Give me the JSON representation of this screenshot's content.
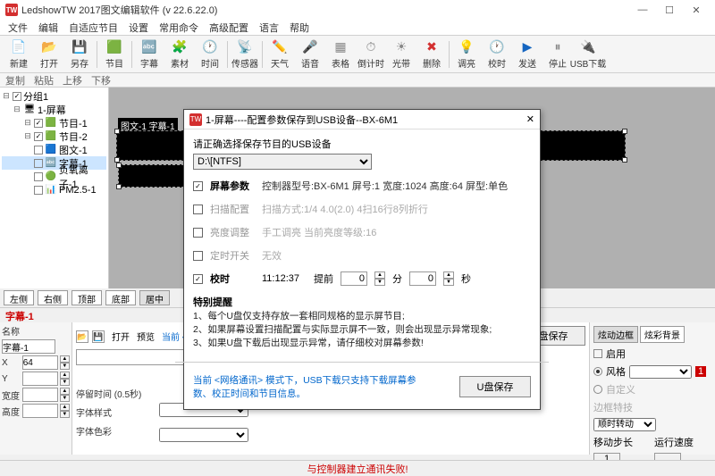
{
  "window": {
    "title": "LedshowTW 2017图文编辑软件 (v 22.6.22.0)",
    "min": "—",
    "max": "☐",
    "close": "✕"
  },
  "menu": [
    "文件",
    "编辑",
    "自适应节目",
    "设置",
    "常用命令",
    "高级配置",
    "语言",
    "帮助"
  ],
  "toolbar": [
    {
      "icon": "📄",
      "label": "新建",
      "color": "c-blue"
    },
    {
      "icon": "📂",
      "label": "打开",
      "color": "c-orange"
    },
    {
      "icon": "💾",
      "label": "另存",
      "color": "c-blue"
    },
    {
      "sep": true
    },
    {
      "icon": "🟩",
      "label": "节目",
      "color": "c-green"
    },
    {
      "sep": true
    },
    {
      "icon": "🔤",
      "label": "字幕",
      "color": "c-blue"
    },
    {
      "icon": "🧩",
      "label": "素材",
      "color": "c-green"
    },
    {
      "icon": "🕐",
      "label": "时间",
      "color": "c-green"
    },
    {
      "sep": true
    },
    {
      "icon": "📡",
      "label": "传感器",
      "color": "c-blue"
    },
    {
      "sep": true
    },
    {
      "icon": "✏️",
      "label": "天气",
      "color": "c-blue"
    },
    {
      "icon": "🎤",
      "label": "语音",
      "color": "c-gray"
    },
    {
      "icon": "▦",
      "label": "表格",
      "color": "c-gray"
    },
    {
      "icon": "⏱",
      "label": "倒计时",
      "color": "c-gray"
    },
    {
      "icon": "☀",
      "label": "光带",
      "color": "c-gray"
    },
    {
      "icon": "✖",
      "label": "删除",
      "color": "c-red"
    },
    {
      "sep": true
    },
    {
      "icon": "💡",
      "label": "调亮",
      "color": "c-orange"
    },
    {
      "icon": "🕐",
      "label": "校时",
      "color": "c-green"
    },
    {
      "icon": "▶",
      "label": "发送",
      "color": "c-blue"
    },
    {
      "icon": "⏸",
      "label": "停止",
      "color": "c-gray"
    },
    {
      "icon": "🔌",
      "label": "USB下载",
      "color": "c-green"
    }
  ],
  "subtool": [
    "复制",
    "粘贴",
    "上移",
    "下移"
  ],
  "tree": {
    "group": "分组1",
    "screen": "1-屏幕",
    "items": [
      {
        "label": "节目-1",
        "chk": true,
        "icon": "🟩"
      },
      {
        "label": "节目-2",
        "chk": true,
        "icon": "🟩"
      },
      {
        "label": "图文-1",
        "chk": false,
        "icon": "🟦"
      },
      {
        "label": "字幕-1",
        "chk": false,
        "icon": "🔤",
        "sel": true
      },
      {
        "label": "负氧离子-1",
        "chk": false,
        "icon": "🟢"
      },
      {
        "label": "PM2.5-1",
        "chk": false,
        "icon": "📊"
      }
    ]
  },
  "canvas": {
    "strip_label": "图文-1  字幕-1"
  },
  "tabs": [
    "左侧",
    "右侧",
    "顶部",
    "底部",
    "居中"
  ],
  "caption": "字幕-1",
  "props": {
    "name_label": "名称",
    "name_value": "字幕-1",
    "x_label": "X",
    "x_value": "64",
    "y_label": "Y",
    "y_value": "",
    "w_label": "宽度",
    "w_value": "",
    "h_label": "高度",
    "h_value": ""
  },
  "mid": {
    "open": "打开",
    "preview": "预览",
    "note": "当前 <网络通讯> 模式下，USB下载只支持下载屏幕参数、校正时间和节目信息。",
    "usb_save": "U盘保存",
    "pause_label": "停留时间 (0.5秒)",
    "style_label": "字体样式",
    "color_label": "字体色彩"
  },
  "right": {
    "tab1": "炫动边框",
    "tab2": "炫彩背景",
    "enable": "启用",
    "style_label": "风格",
    "style_sel": "",
    "style_count": "1",
    "custom": "自定义",
    "effect": "边框特技",
    "effect_sel": "顺时转动",
    "step": "移动步长",
    "step_val": "1",
    "speed": "运行速度",
    "speed_val": ""
  },
  "status": "与控制器建立通讯失败!",
  "dialog": {
    "title": "1-屏幕----配置参数保存到USB设备--BX-6M1",
    "choose": "请正确选择保存节目的USB设备",
    "usb_value": "D:\\[NTFS]",
    "sec_screen": {
      "chk": true,
      "lab": "屏幕参数",
      "detail": "控制器型号:BX-6M1    屏号:1  宽度:1024  高度:64  屏型:单色"
    },
    "sec_scan": {
      "chk": false,
      "lab": "扫描配置",
      "detail": "扫描方式:1/4    4.0(2.0)  4扫16行8列折行"
    },
    "sec_bright": {
      "chk": false,
      "lab": "亮度调整",
      "detail": "手工调亮  当前亮度等级:16"
    },
    "sec_timer": {
      "chk": false,
      "lab": "定时开关",
      "detail": "无效"
    },
    "sec_time": {
      "chk": true,
      "lab": "校时",
      "time": "11:12:37",
      "pre": "提前",
      "min": "0",
      "min_u": "分",
      "sec": "0",
      "sec_u": "秒"
    },
    "remind_h": "特别提醒",
    "remind1": "1、每个U盘仅支持存放一套相同规格的显示屏节目;",
    "remind2": "2、如果屏幕设置扫描配置与实际显示屏不一致，则会出现显示异常现象;",
    "remind3": "3、如果U盘下载后出现显示异常，请仔细校对屏幕参数!",
    "bottom_msg": "当前 <网络通讯> 模式下，USB下载只支持下载屏幕参数、校正时间和节目信息。",
    "save_btn": "U盘保存"
  }
}
